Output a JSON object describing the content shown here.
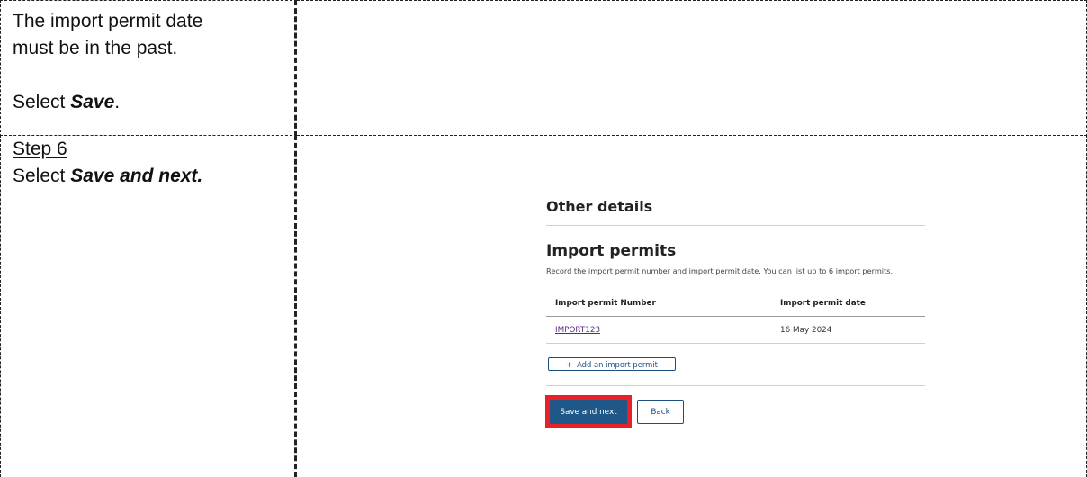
{
  "rows": [
    {
      "lines": [
        {
          "text": "The import permit date"
        },
        {
          "text": "must be in the past."
        },
        {
          "text": ""
        },
        {
          "prefix": "Select ",
          "emphasis": "Save",
          "suffix": "."
        }
      ]
    },
    {
      "step_label": "Step 6",
      "instruction": {
        "prefix": "Select ",
        "emphasis": "Save and next."
      }
    }
  ],
  "screenshot": {
    "section_title": "Other details",
    "subsection_title": "Import permits",
    "description": "Record the import permit number and import permit date. You can list up to 6 import permits.",
    "table": {
      "headers": [
        "Import permit Number",
        "Import permit date"
      ],
      "rows": [
        {
          "number": "IMPORT123",
          "date": "16 May 2024"
        }
      ]
    },
    "add_button_label": "Add an import permit",
    "save_next_label": "Save and next",
    "back_label": "Back",
    "colors": {
      "primary": "#1f5788",
      "link": "#5b2a86",
      "highlight": "#e8202a"
    }
  }
}
